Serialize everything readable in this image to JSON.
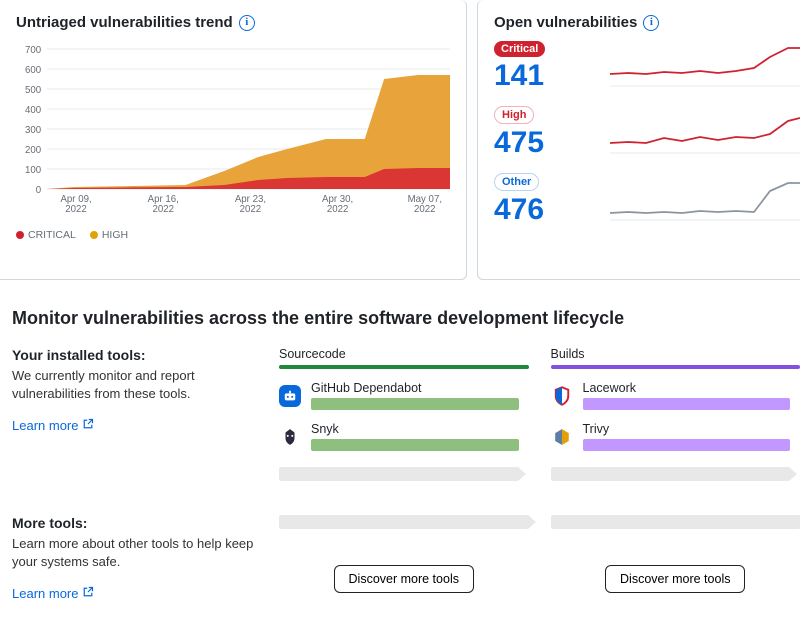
{
  "trend": {
    "title": "Untriaged vulnerabilities trend",
    "legend": {
      "critical": "CRITICAL",
      "high": "HIGH"
    },
    "colors": {
      "critical": "#cf222e",
      "high": "#e3a008",
      "grid": "#e7e9eb"
    }
  },
  "open": {
    "title": "Open vulnerabilities",
    "critical": {
      "label": "Critical",
      "count": "141"
    },
    "high": {
      "label": "High",
      "count": "475"
    },
    "other": {
      "label": "Other",
      "count": "476"
    }
  },
  "monitor": {
    "heading": "Monitor vulnerabilities across the entire software development lifecycle",
    "installed": {
      "title": "Your installed tools:",
      "desc": "We currently monitor and report vulnerabilities from these tools.",
      "learn_more": "Learn more"
    },
    "more": {
      "title": "More tools:",
      "desc": "Learn more about other tools to help keep your systems safe.",
      "learn_more": "Learn more"
    },
    "stages": {
      "sourcecode": {
        "label": "Sourcecode",
        "tools": [
          {
            "name": "GitHub Dependabot"
          },
          {
            "name": "Snyk"
          }
        ]
      },
      "builds": {
        "label": "Builds",
        "tools": [
          {
            "name": "Lacework"
          },
          {
            "name": "Trivy"
          }
        ]
      }
    },
    "discover_label": "Discover more tools"
  },
  "chart_data": {
    "type": "area",
    "title": "Untriaged vulnerabilities trend",
    "xlabel": "",
    "ylabel": "",
    "ylim": [
      0,
      700
    ],
    "x_ticks": [
      "Apr 09, 2022",
      "Apr 16, 2022",
      "Apr 23, 2022",
      "Apr 30, 2022",
      "May 07, 2022"
    ],
    "y_ticks": [
      0,
      100,
      200,
      300,
      400,
      500,
      600,
      700
    ],
    "series": [
      {
        "name": "HIGH",
        "color": "#e3a008",
        "x": [
          "Apr 09",
          "Apr 11",
          "Apr 16",
          "Apr 20",
          "Apr 23",
          "Apr 25",
          "Apr 27",
          "Apr 30",
          "May 03",
          "May 04",
          "May 07",
          "May 10"
        ],
        "values": [
          0,
          10,
          15,
          20,
          90,
          160,
          200,
          250,
          250,
          550,
          570,
          570
        ]
      },
      {
        "name": "CRITICAL",
        "color": "#cf222e",
        "x": [
          "Apr 09",
          "Apr 11",
          "Apr 16",
          "Apr 20",
          "Apr 23",
          "Apr 25",
          "Apr 27",
          "Apr 30",
          "May 03",
          "May 04",
          "May 07",
          "May 10"
        ],
        "values": [
          0,
          5,
          8,
          10,
          20,
          45,
          55,
          60,
          60,
          100,
          105,
          105
        ]
      }
    ],
    "sparklines": {
      "critical": [
        120,
        122,
        121,
        124,
        123,
        125,
        124,
        126,
        128,
        135,
        141,
        141
      ],
      "high": [
        430,
        432,
        431,
        445,
        440,
        446,
        444,
        448,
        450,
        452,
        470,
        475
      ],
      "other": [
        410,
        412,
        411,
        413,
        412,
        414,
        413,
        415,
        414,
        460,
        476,
        476
      ]
    }
  }
}
